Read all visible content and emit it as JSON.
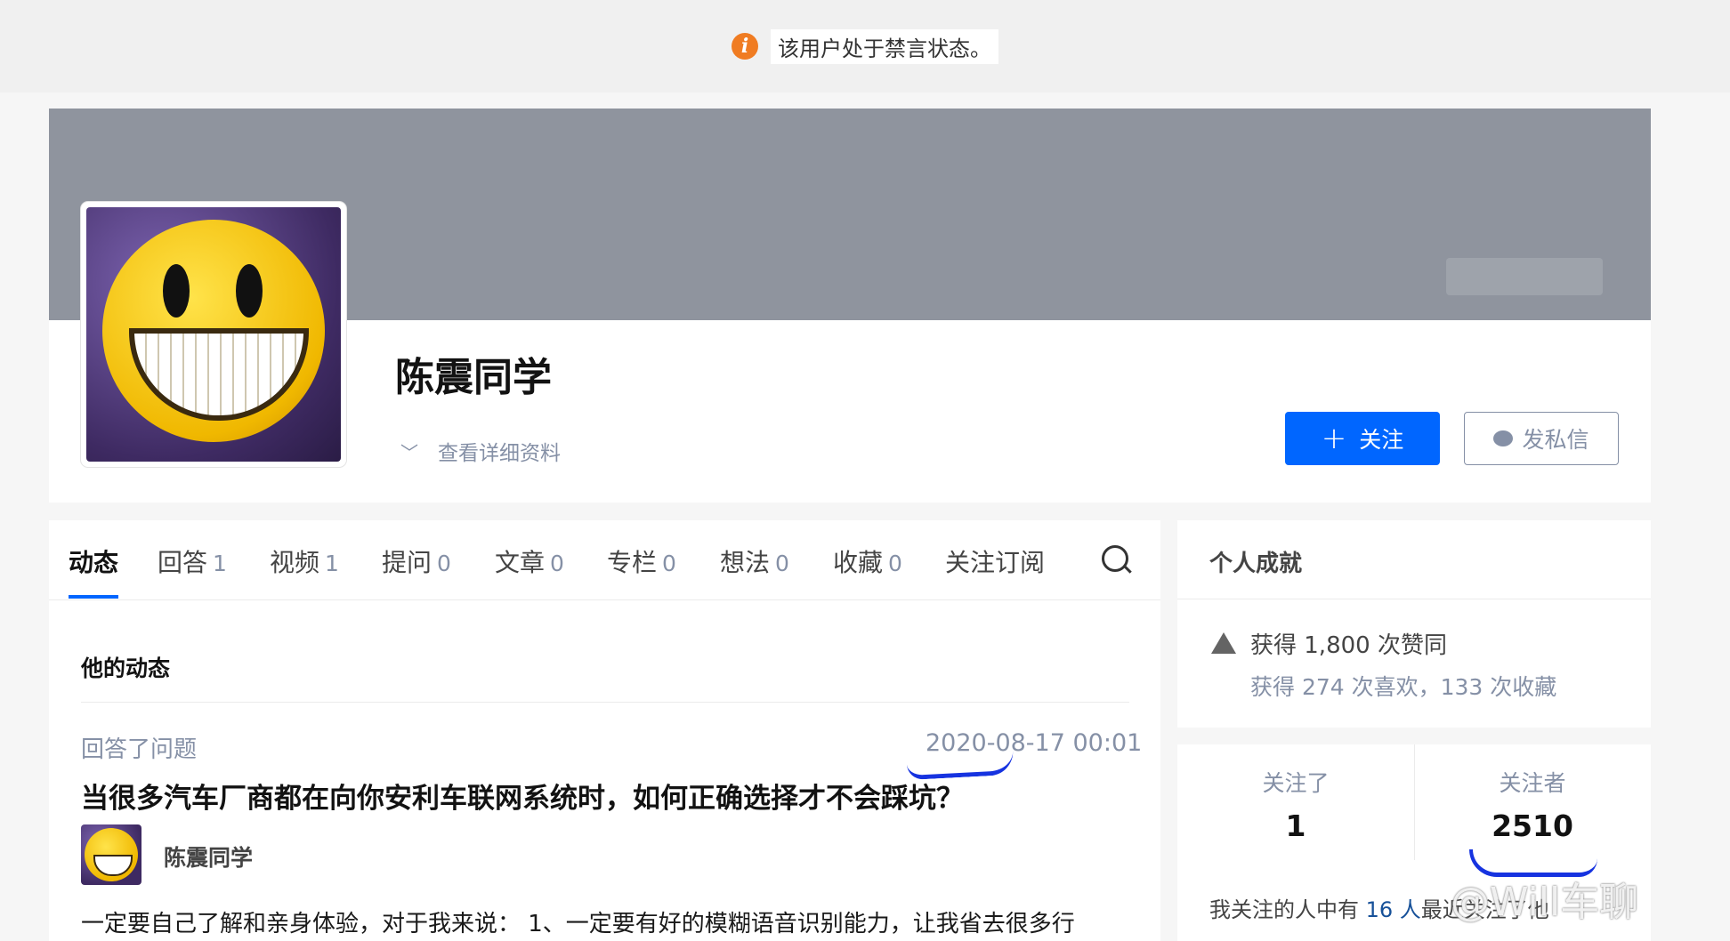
{
  "notice": {
    "text": "该用户处于禁言状态。"
  },
  "profile": {
    "name": "陈震同学",
    "detail_link": "查看详细资料",
    "follow_label": "关注",
    "message_label": "发私信"
  },
  "tabs": [
    {
      "label": "动态",
      "count": ""
    },
    {
      "label": "回答",
      "count": "1"
    },
    {
      "label": "视频",
      "count": "1"
    },
    {
      "label": "提问",
      "count": "0"
    },
    {
      "label": "文章",
      "count": "0"
    },
    {
      "label": "专栏",
      "count": "0"
    },
    {
      "label": "想法",
      "count": "0"
    },
    {
      "label": "收藏",
      "count": "0"
    },
    {
      "label": "关注订阅",
      "count": ""
    }
  ],
  "feed": {
    "section_title": "他的动态",
    "item": {
      "action": "回答了问题",
      "date": "2020-08-17 00:01",
      "title": "当很多汽车厂商都在向你安利车联网系统时，如何正确选择才不会踩坑？",
      "author": "陈震同学",
      "excerpt": "一定要自己了解和亲身体验，对于我来说： 1、一定要有好的模糊语音识别能力，让我省去很多行"
    }
  },
  "achievements": {
    "title": "个人成就",
    "line1": "获得 1,800 次赞同",
    "line2": "获得 274 次喜欢，133 次收藏"
  },
  "follow_stats": {
    "following_label": "关注了",
    "following_value": "1",
    "followers_label": "关注者",
    "followers_value": "2510",
    "mutual_prefix": "我关注的人中有 ",
    "mutual_count": "16 人",
    "mutual_suffix": "最近关注了他"
  },
  "watermark": "@Will车聊",
  "colors": {
    "primary": "#0066ff",
    "notice_icon": "#f07c22",
    "annotation": "#1633e0"
  }
}
